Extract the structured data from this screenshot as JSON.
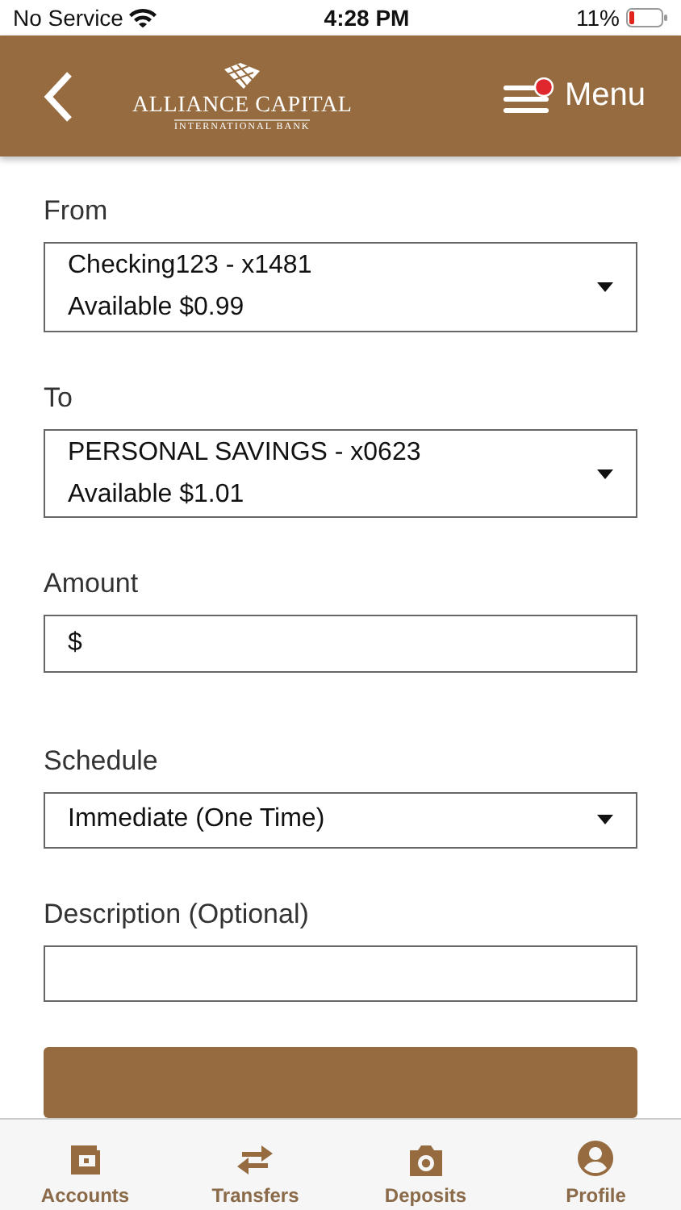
{
  "status_bar": {
    "carrier": "No Service",
    "time": "4:28 PM",
    "battery": "11%"
  },
  "header": {
    "logo_title": "ALLIANCE CAPITAL",
    "logo_subtitle": "INTERNATIONAL BANK",
    "menu_label": "Menu",
    "menu_notification": true
  },
  "form": [
    {
      "kind": "select",
      "label": "From",
      "line1": "Checking123 - x1481",
      "line2": "Available $0.99"
    },
    {
      "kind": "select",
      "label": "To",
      "line1": "PERSONAL SAVINGS - x0623",
      "line2": "Available $1.01"
    },
    {
      "kind": "amount",
      "label": "Amount",
      "prefix": "$"
    },
    {
      "kind": "select",
      "label": "Schedule",
      "line1": "Immediate (One Time)"
    },
    {
      "kind": "text",
      "label": "Description (Optional)"
    }
  ],
  "tab_bar": [
    {
      "label": "Accounts",
      "kind": "wallet"
    },
    {
      "label": "Transfers",
      "kind": "arrows"
    },
    {
      "label": "Deposits",
      "kind": "camera"
    },
    {
      "label": "Profile",
      "kind": "person"
    }
  ]
}
